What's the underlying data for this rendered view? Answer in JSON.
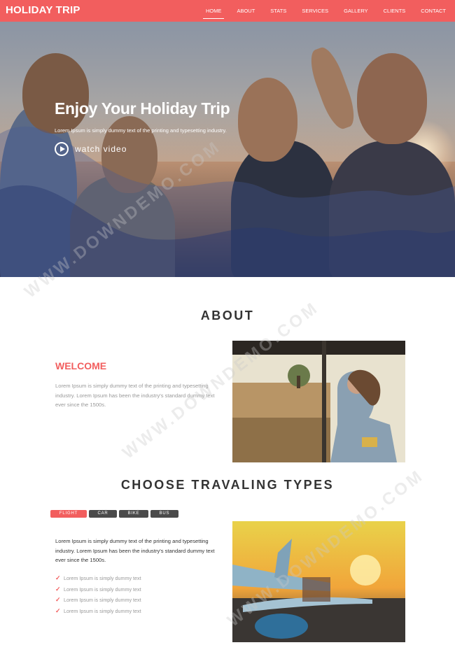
{
  "nav": {
    "brand": "HOLIDAY TRIP",
    "items": [
      {
        "label": "HOME",
        "active": true
      },
      {
        "label": "ABOUT",
        "active": false
      },
      {
        "label": "STATS",
        "active": false
      },
      {
        "label": "SERVICES",
        "active": false
      },
      {
        "label": "GALLERY",
        "active": false
      },
      {
        "label": "CLIENTS",
        "active": false
      },
      {
        "label": "CONTACT",
        "active": false
      }
    ]
  },
  "hero": {
    "title": "Enjoy Your Holiday Trip",
    "subtitle": "Lorem Ipsum is simply dummy text of the printing and typesetting industry.",
    "watch_label": "watch video"
  },
  "about": {
    "title": "ABOUT",
    "welcome": "WELCOME",
    "text": "Lorem Ipsum is simply dummy text of the printing and typesetting industry. Lorem Ipsum has been the industry's standard dummy text ever since the 1500s."
  },
  "types": {
    "title": "CHOOSE TRAVALING TYPES",
    "tabs": [
      {
        "label": "FLIGHT",
        "active": true
      },
      {
        "label": "CAR",
        "active": false
      },
      {
        "label": "BIKE",
        "active": false
      },
      {
        "label": "BUS",
        "active": false
      }
    ],
    "text": "Lorem Ipsum is simply dummy text of the printing and typesetting industry. Lorem Ipsum has been the industry's standard dummy text ever since the 1500s.",
    "checklist": [
      "Lorem Ipsum is simply dummy text",
      "Lorem Ipsum is simply dummy text",
      "Lorem Ipsum is simply dummy text",
      "Lorem Ipsum is simply dummy text"
    ]
  },
  "watermark": "WWW.DOWNDEMO.COM",
  "colors": {
    "accent": "#f25e5e",
    "tab_inactive": "#4a4a4a"
  }
}
